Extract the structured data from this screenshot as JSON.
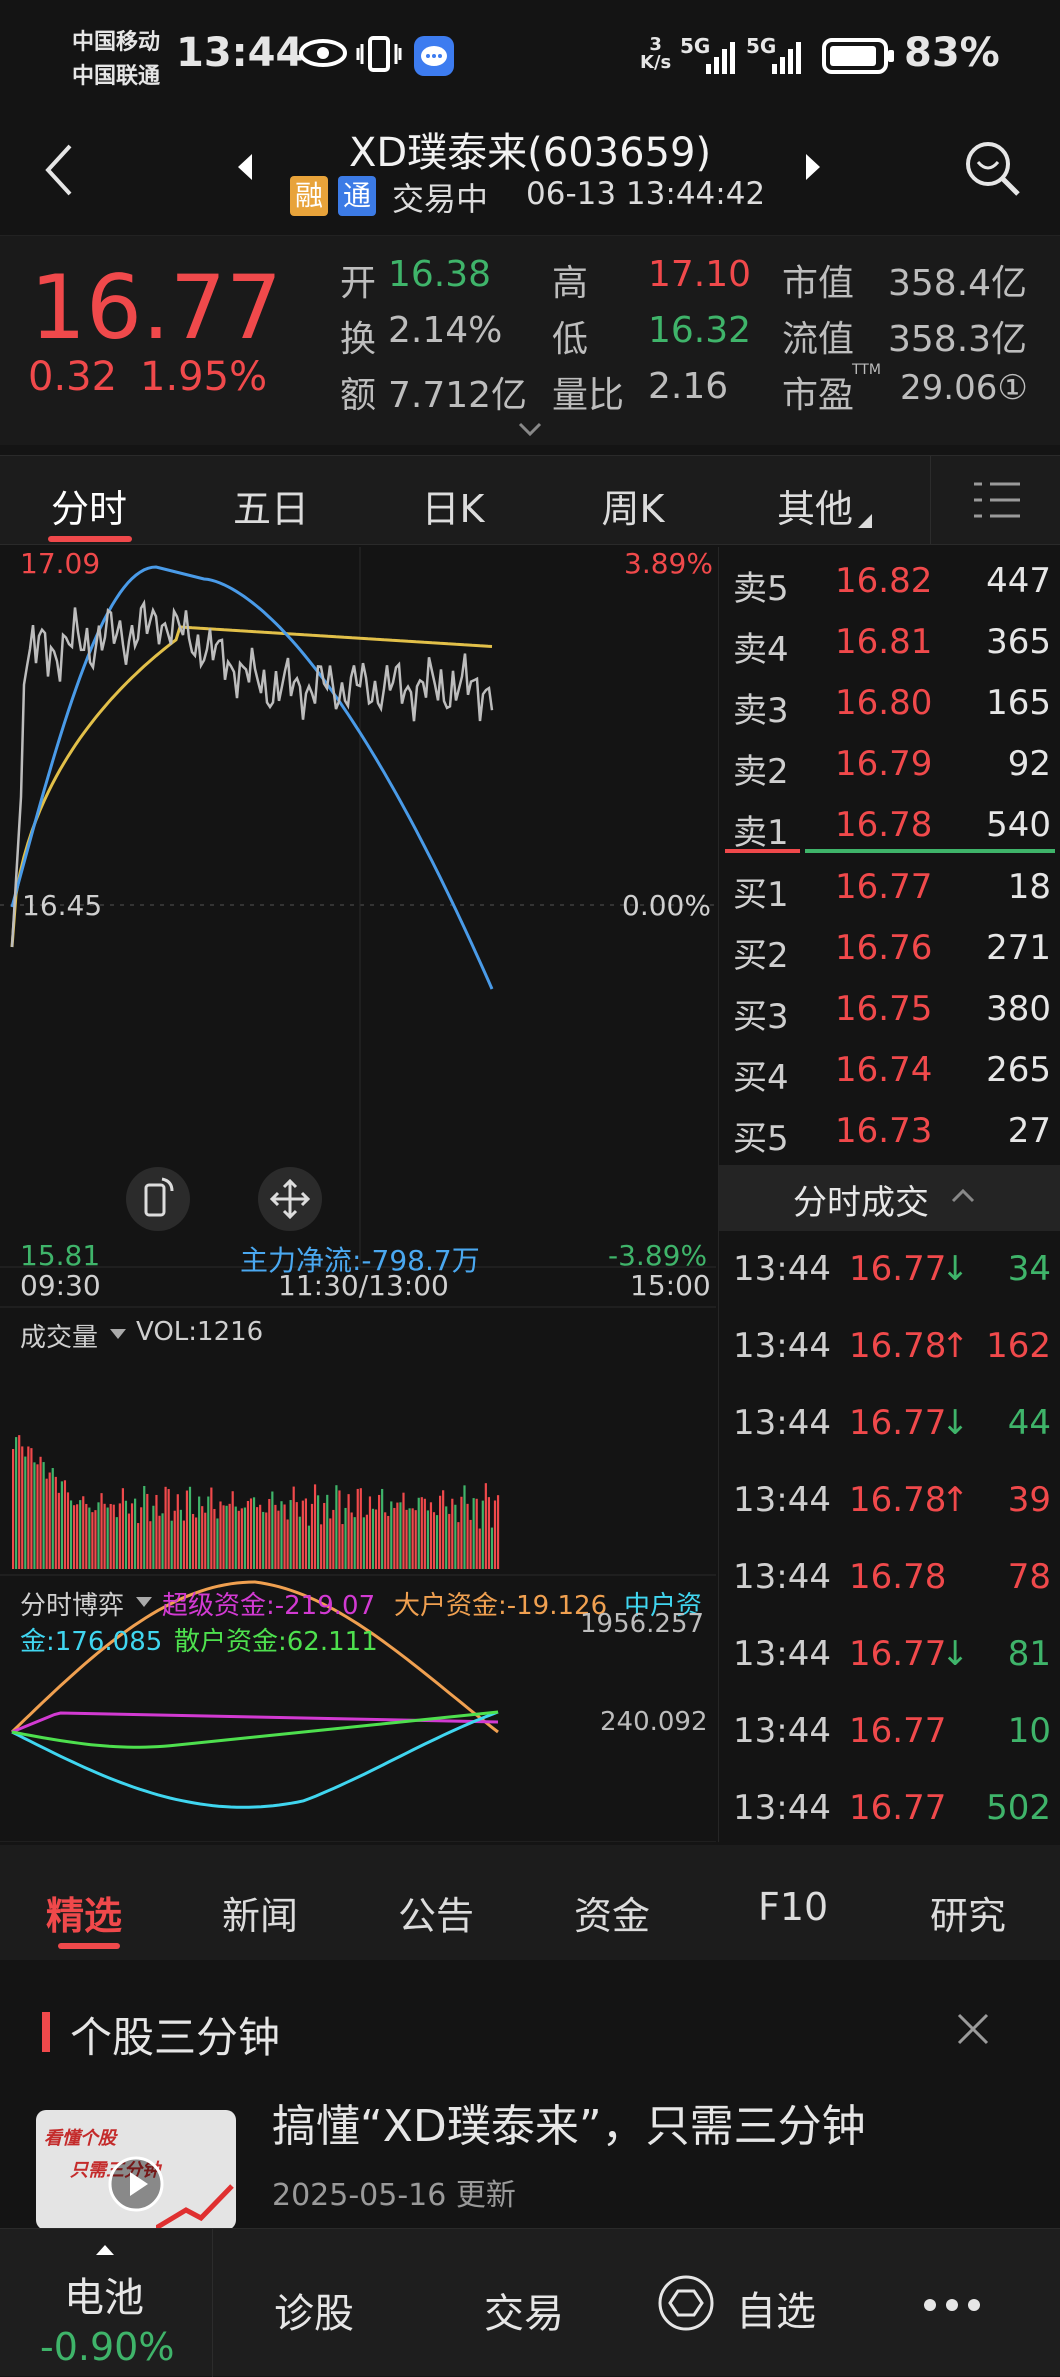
{
  "status": {
    "carrier1": "中国移动",
    "carrier2": "中国联通",
    "time": "13:44",
    "speed_top": "3",
    "speed_unit": "K/s",
    "net1": "5G",
    "net2": "5G",
    "battery": "83%"
  },
  "header": {
    "title": "XD璞泰来(603659)",
    "badge_rong": "融",
    "badge_tong": "通",
    "trade_status": "交易中",
    "datetime": "06-13 13:44:42"
  },
  "quote": {
    "price": "16.77",
    "change": "0.32",
    "change_pct": "1.95%",
    "labels": {
      "open": "开",
      "high": "高",
      "mcap": "市值",
      "turnover": "换",
      "low": "低",
      "float_mcap": "流值",
      "amount": "额",
      "vol_ratio": "量比",
      "pe": "市盈"
    },
    "open": "16.38",
    "high": "17.10",
    "mcap": "358.4亿",
    "turnover": "2.14%",
    "low": "16.32",
    "float_mcap": "358.3亿",
    "amount": "7.712亿",
    "vol_ratio": "2.16",
    "pe_sup": "TTM",
    "pe": "29.06①"
  },
  "tabs": [
    "分时",
    "五日",
    "日K",
    "周K",
    "其他"
  ],
  "chart": {
    "y_top": "17.09",
    "pct_top": "3.89%",
    "y_mid": "16.45",
    "pct_mid": "0.00%",
    "y_bot": "15.81",
    "pct_bot": "-3.89%",
    "main_flow": "主力净流:-798.7万",
    "t_start": "09:30",
    "t_mid": "11:30/13:00",
    "t_end": "15:00"
  },
  "volume": {
    "label": "成交量",
    "vol": "VOL:1216"
  },
  "game": {
    "label": "分时博弈",
    "super": "超级资金:-219.07",
    "large": "大户资金:-19.126",
    "mid1": "中户资",
    "mid2": "金:176.085",
    "retail": "散户资金:62.111",
    "v1": "1956.257",
    "v2": "240.092"
  },
  "colors": {
    "red": "#f0494b",
    "green": "#3fb46a",
    "price_line": "#bdbdbd",
    "avg_line": "#e2c049",
    "blue_line": "#4a9be8",
    "orange": "#f0a050",
    "magenta": "#d23ad2",
    "cyan": "#40d6f0",
    "lime": "#4ee04e"
  },
  "orderbook": {
    "asks": [
      {
        "label": "卖5",
        "price": "16.82",
        "vol": "447"
      },
      {
        "label": "卖4",
        "price": "16.81",
        "vol": "365"
      },
      {
        "label": "卖3",
        "price": "16.80",
        "vol": "165"
      },
      {
        "label": "卖2",
        "price": "16.79",
        "vol": "92"
      },
      {
        "label": "卖1",
        "price": "16.78",
        "vol": "540"
      }
    ],
    "bids": [
      {
        "label": "买1",
        "price": "16.77",
        "vol": "18"
      },
      {
        "label": "买2",
        "price": "16.76",
        "vol": "271"
      },
      {
        "label": "买3",
        "price": "16.75",
        "vol": "380"
      },
      {
        "label": "买4",
        "price": "16.74",
        "vol": "265"
      },
      {
        "label": "买5",
        "price": "16.73",
        "vol": "27"
      }
    ],
    "trades_title": "分时成交",
    "trades": [
      {
        "time": "13:44",
        "price": "16.77",
        "arrow": "↓",
        "vol": "34",
        "dir": "down"
      },
      {
        "time": "13:44",
        "price": "16.78",
        "arrow": "↑",
        "vol": "162",
        "dir": "up"
      },
      {
        "time": "13:44",
        "price": "16.77",
        "arrow": "↓",
        "vol": "44",
        "dir": "down"
      },
      {
        "time": "13:44",
        "price": "16.78",
        "arrow": "↑",
        "vol": "39",
        "dir": "up"
      },
      {
        "time": "13:44",
        "price": "16.78",
        "arrow": "",
        "vol": "78",
        "dir": "up"
      },
      {
        "time": "13:44",
        "price": "16.77",
        "arrow": "↓",
        "vol": "81",
        "dir": "down"
      },
      {
        "time": "13:44",
        "price": "16.77",
        "arrow": "",
        "vol": "10",
        "dir": "down"
      },
      {
        "time": "13:44",
        "price": "16.77",
        "arrow": "",
        "vol": "502",
        "dir": "down"
      }
    ]
  },
  "bottom_tabs": [
    "精选",
    "新闻",
    "公告",
    "资金",
    "F10",
    "研究"
  ],
  "news": {
    "section": "个股三分钟",
    "headline": "搞懂“XD璞泰来”，只需三分钟",
    "date": "2025-05-16 更新",
    "thumb_text1": "看懂个股",
    "thumb_text2": "只需三分钟"
  },
  "nav": {
    "stock_name": "电池",
    "stock_change": "-0.90%",
    "diag": "诊股",
    "trade": "交易",
    "watch": "自选"
  }
}
